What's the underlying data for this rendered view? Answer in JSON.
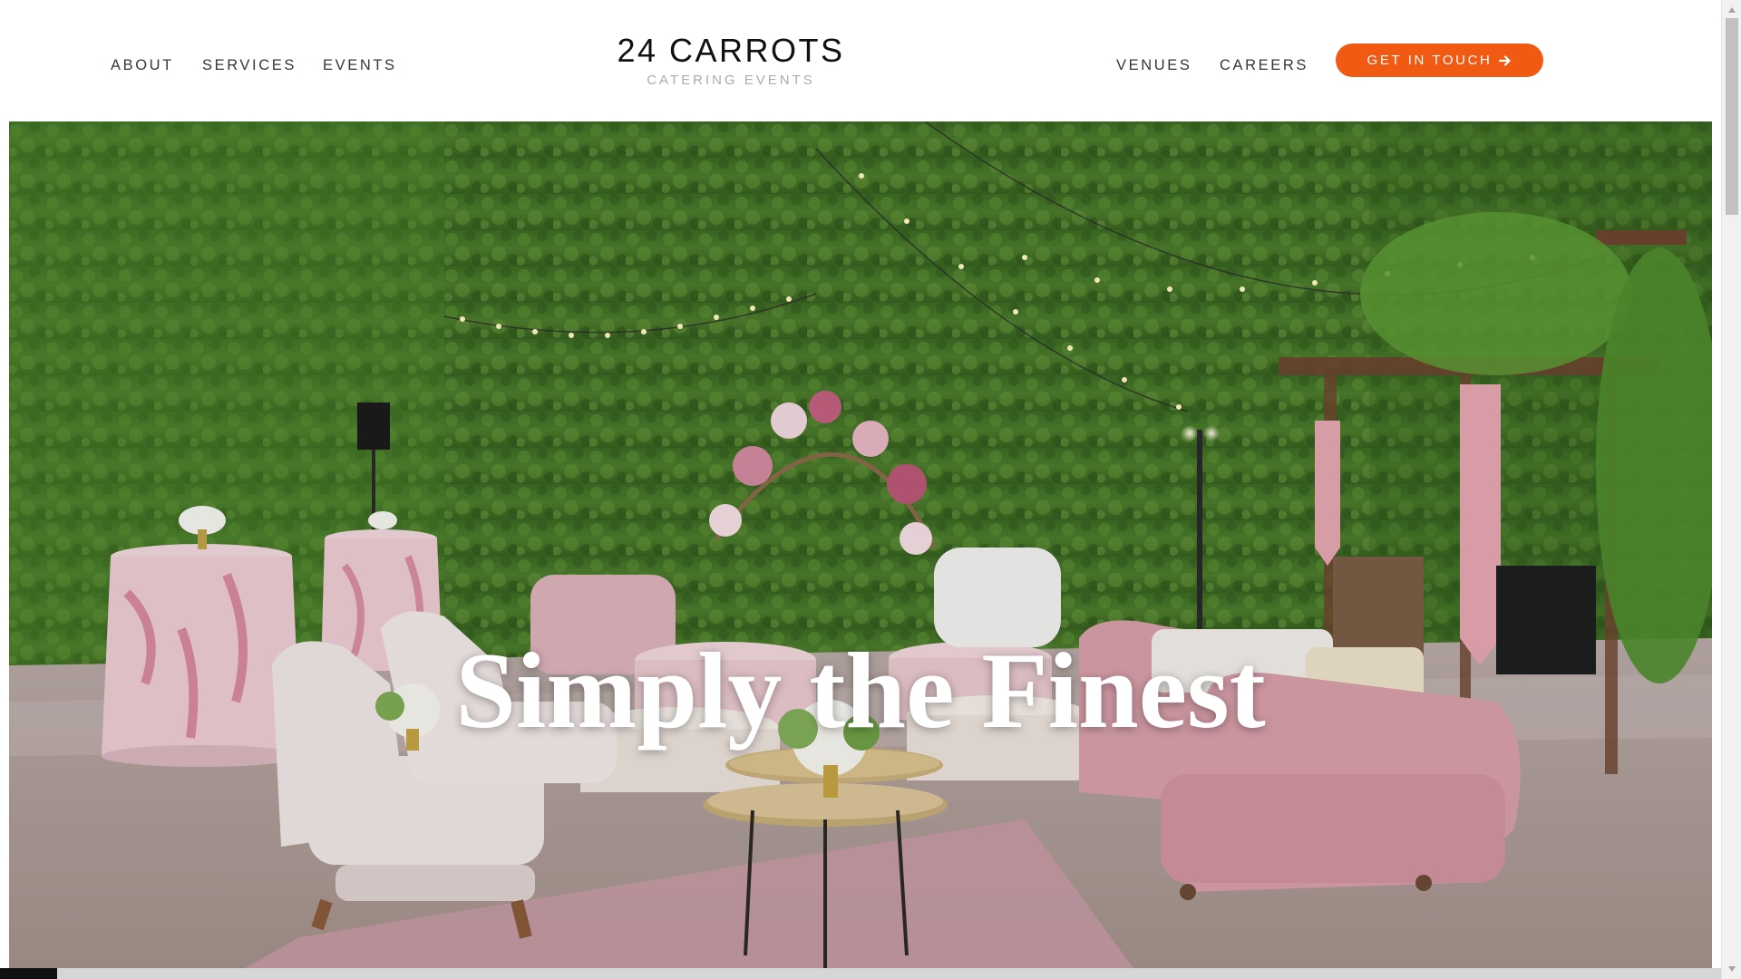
{
  "header": {
    "nav_left": [
      "ABOUT",
      "SERVICES",
      "EVENTS"
    ],
    "nav_right": [
      "VENUES",
      "CAREERS"
    ],
    "logo_title": "24 CARROTS",
    "logo_subtitle": "CATERING EVENTS",
    "cta_label": "GET IN TOUCH",
    "cta_icon": "arrow-right-icon"
  },
  "hero": {
    "heading": "Simply the Finest",
    "image_description_icon": "hero-photo"
  },
  "colors": {
    "accent": "#f05a12",
    "nav_text": "#2f3a33",
    "logo_subtitle": "#a7aea9"
  },
  "video_progress": 0.033
}
